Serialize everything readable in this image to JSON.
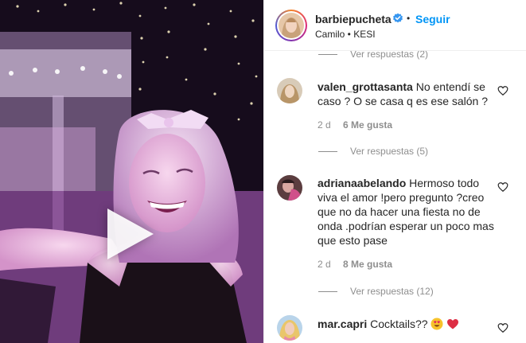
{
  "post": {
    "username": "barbiepucheta",
    "follow_label": "Seguir",
    "separator": "•",
    "location": "Camilo • KESI"
  },
  "top_replies": {
    "label": "Ver respuestas (2)"
  },
  "comments": [
    {
      "username": "valen_grottasanta",
      "text": "No entendí se caso ? O se casa q es ese salón ?",
      "age": "2 d",
      "likes": "6 Me gusta",
      "replies_label": "Ver respuestas (5)"
    },
    {
      "username": "adrianaabelando",
      "text": "Hermoso todo viva el amor !pero pregunto ?creo que no da hacer una fiesta no de onda .podrían esperar un poco mas que esto pase",
      "age": "2 d",
      "likes": "8 Me gusta",
      "replies_label": "Ver respuestas (12)"
    },
    {
      "username": "mar.capri",
      "text": "Cocktails??",
      "emojis": [
        "heart-eyes-emoji",
        "red-heart-emoji"
      ]
    }
  ],
  "colors": {
    "link_blue": "#0095f6",
    "verified_blue": "#3897f0",
    "meta_gray": "#8e8e8e",
    "heart_red": "#ed4956"
  }
}
